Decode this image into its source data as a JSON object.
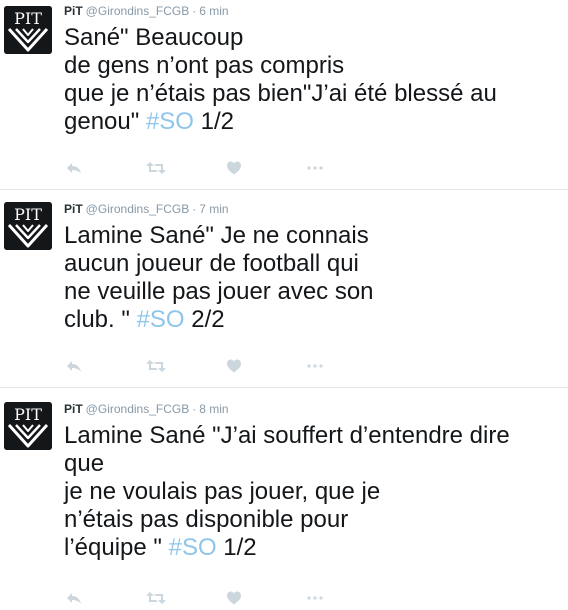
{
  "author": {
    "name": "PiT",
    "handle": "@Girondins_FCGB",
    "avatar_text": "PIT"
  },
  "separator": "·",
  "tweets": [
    {
      "time": "6 min",
      "lines": [
        "Sané\" Beaucoup",
        "de gens n’ont pas compris",
        "que je n’étais pas bien\"J’ai été blessé au",
        "genou\" "
      ],
      "hashtag": "#SO",
      "suffix": " 1/2"
    },
    {
      "time": "7 min",
      "lines": [
        "Lamine Sané\" Je ne connais",
        "aucun joueur de football qui",
        "ne veuille pas jouer avec son",
        "club. \" "
      ],
      "hashtag": "#SO",
      "suffix": " 2/2"
    },
    {
      "time": "8 min",
      "lines": [
        "Lamine Sané \"J’ai souffert d’entendre dire",
        "que",
        "je ne voulais pas jouer, que je",
        "n’étais pas disponible pour",
        "l’équipe \" "
      ],
      "hashtag": "#SO",
      "suffix": " 1/2"
    }
  ],
  "icons": [
    "reply-icon",
    "retweet-icon",
    "like-icon",
    "more-icon"
  ],
  "colors": {
    "hashtag": "#8ec5ea",
    "meta": "#8899a6",
    "icon": "#ccd6dd",
    "avatar_bg": "#14171a"
  }
}
